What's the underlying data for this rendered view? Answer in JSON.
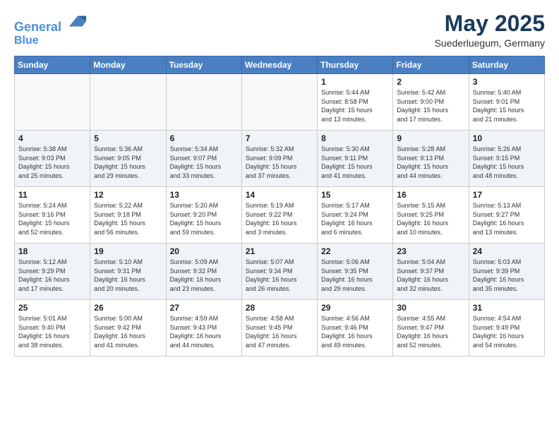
{
  "header": {
    "logo_line1": "General",
    "logo_line2": "Blue",
    "month_title": "May 2025",
    "subtitle": "Suederluegum, Germany"
  },
  "weekdays": [
    "Sunday",
    "Monday",
    "Tuesday",
    "Wednesday",
    "Thursday",
    "Friday",
    "Saturday"
  ],
  "weeks": [
    [
      {
        "day": "",
        "info": ""
      },
      {
        "day": "",
        "info": ""
      },
      {
        "day": "",
        "info": ""
      },
      {
        "day": "",
        "info": ""
      },
      {
        "day": "1",
        "info": "Sunrise: 5:44 AM\nSunset: 8:58 PM\nDaylight: 15 hours\nand 13 minutes."
      },
      {
        "day": "2",
        "info": "Sunrise: 5:42 AM\nSunset: 9:00 PM\nDaylight: 15 hours\nand 17 minutes."
      },
      {
        "day": "3",
        "info": "Sunrise: 5:40 AM\nSunset: 9:01 PM\nDaylight: 15 hours\nand 21 minutes."
      }
    ],
    [
      {
        "day": "4",
        "info": "Sunrise: 5:38 AM\nSunset: 9:03 PM\nDaylight: 15 hours\nand 25 minutes."
      },
      {
        "day": "5",
        "info": "Sunrise: 5:36 AM\nSunset: 9:05 PM\nDaylight: 15 hours\nand 29 minutes."
      },
      {
        "day": "6",
        "info": "Sunrise: 5:34 AM\nSunset: 9:07 PM\nDaylight: 15 hours\nand 33 minutes."
      },
      {
        "day": "7",
        "info": "Sunrise: 5:32 AM\nSunset: 9:09 PM\nDaylight: 15 hours\nand 37 minutes."
      },
      {
        "day": "8",
        "info": "Sunrise: 5:30 AM\nSunset: 9:11 PM\nDaylight: 15 hours\nand 41 minutes."
      },
      {
        "day": "9",
        "info": "Sunrise: 5:28 AM\nSunset: 9:13 PM\nDaylight: 15 hours\nand 44 minutes."
      },
      {
        "day": "10",
        "info": "Sunrise: 5:26 AM\nSunset: 9:15 PM\nDaylight: 15 hours\nand 48 minutes."
      }
    ],
    [
      {
        "day": "11",
        "info": "Sunrise: 5:24 AM\nSunset: 9:16 PM\nDaylight: 15 hours\nand 52 minutes."
      },
      {
        "day": "12",
        "info": "Sunrise: 5:22 AM\nSunset: 9:18 PM\nDaylight: 15 hours\nand 56 minutes."
      },
      {
        "day": "13",
        "info": "Sunrise: 5:20 AM\nSunset: 9:20 PM\nDaylight: 15 hours\nand 59 minutes."
      },
      {
        "day": "14",
        "info": "Sunrise: 5:19 AM\nSunset: 9:22 PM\nDaylight: 16 hours\nand 3 minutes."
      },
      {
        "day": "15",
        "info": "Sunrise: 5:17 AM\nSunset: 9:24 PM\nDaylight: 16 hours\nand 6 minutes."
      },
      {
        "day": "16",
        "info": "Sunrise: 5:15 AM\nSunset: 9:25 PM\nDaylight: 16 hours\nand 10 minutes."
      },
      {
        "day": "17",
        "info": "Sunrise: 5:13 AM\nSunset: 9:27 PM\nDaylight: 16 hours\nand 13 minutes."
      }
    ],
    [
      {
        "day": "18",
        "info": "Sunrise: 5:12 AM\nSunset: 9:29 PM\nDaylight: 16 hours\nand 17 minutes."
      },
      {
        "day": "19",
        "info": "Sunrise: 5:10 AM\nSunset: 9:31 PM\nDaylight: 16 hours\nand 20 minutes."
      },
      {
        "day": "20",
        "info": "Sunrise: 5:09 AM\nSunset: 9:32 PM\nDaylight: 16 hours\nand 23 minutes."
      },
      {
        "day": "21",
        "info": "Sunrise: 5:07 AM\nSunset: 9:34 PM\nDaylight: 16 hours\nand 26 minutes."
      },
      {
        "day": "22",
        "info": "Sunrise: 5:06 AM\nSunset: 9:35 PM\nDaylight: 16 hours\nand 29 minutes."
      },
      {
        "day": "23",
        "info": "Sunrise: 5:04 AM\nSunset: 9:37 PM\nDaylight: 16 hours\nand 32 minutes."
      },
      {
        "day": "24",
        "info": "Sunrise: 5:03 AM\nSunset: 9:39 PM\nDaylight: 16 hours\nand 35 minutes."
      }
    ],
    [
      {
        "day": "25",
        "info": "Sunrise: 5:01 AM\nSunset: 9:40 PM\nDaylight: 16 hours\nand 38 minutes."
      },
      {
        "day": "26",
        "info": "Sunrise: 5:00 AM\nSunset: 9:42 PM\nDaylight: 16 hours\nand 41 minutes."
      },
      {
        "day": "27",
        "info": "Sunrise: 4:59 AM\nSunset: 9:43 PM\nDaylight: 16 hours\nand 44 minutes."
      },
      {
        "day": "28",
        "info": "Sunrise: 4:58 AM\nSunset: 9:45 PM\nDaylight: 16 hours\nand 47 minutes."
      },
      {
        "day": "29",
        "info": "Sunrise: 4:56 AM\nSunset: 9:46 PM\nDaylight: 16 hours\nand 49 minutes."
      },
      {
        "day": "30",
        "info": "Sunrise: 4:55 AM\nSunset: 9:47 PM\nDaylight: 16 hours\nand 52 minutes."
      },
      {
        "day": "31",
        "info": "Sunrise: 4:54 AM\nSunset: 9:49 PM\nDaylight: 16 hours\nand 54 minutes."
      }
    ]
  ]
}
